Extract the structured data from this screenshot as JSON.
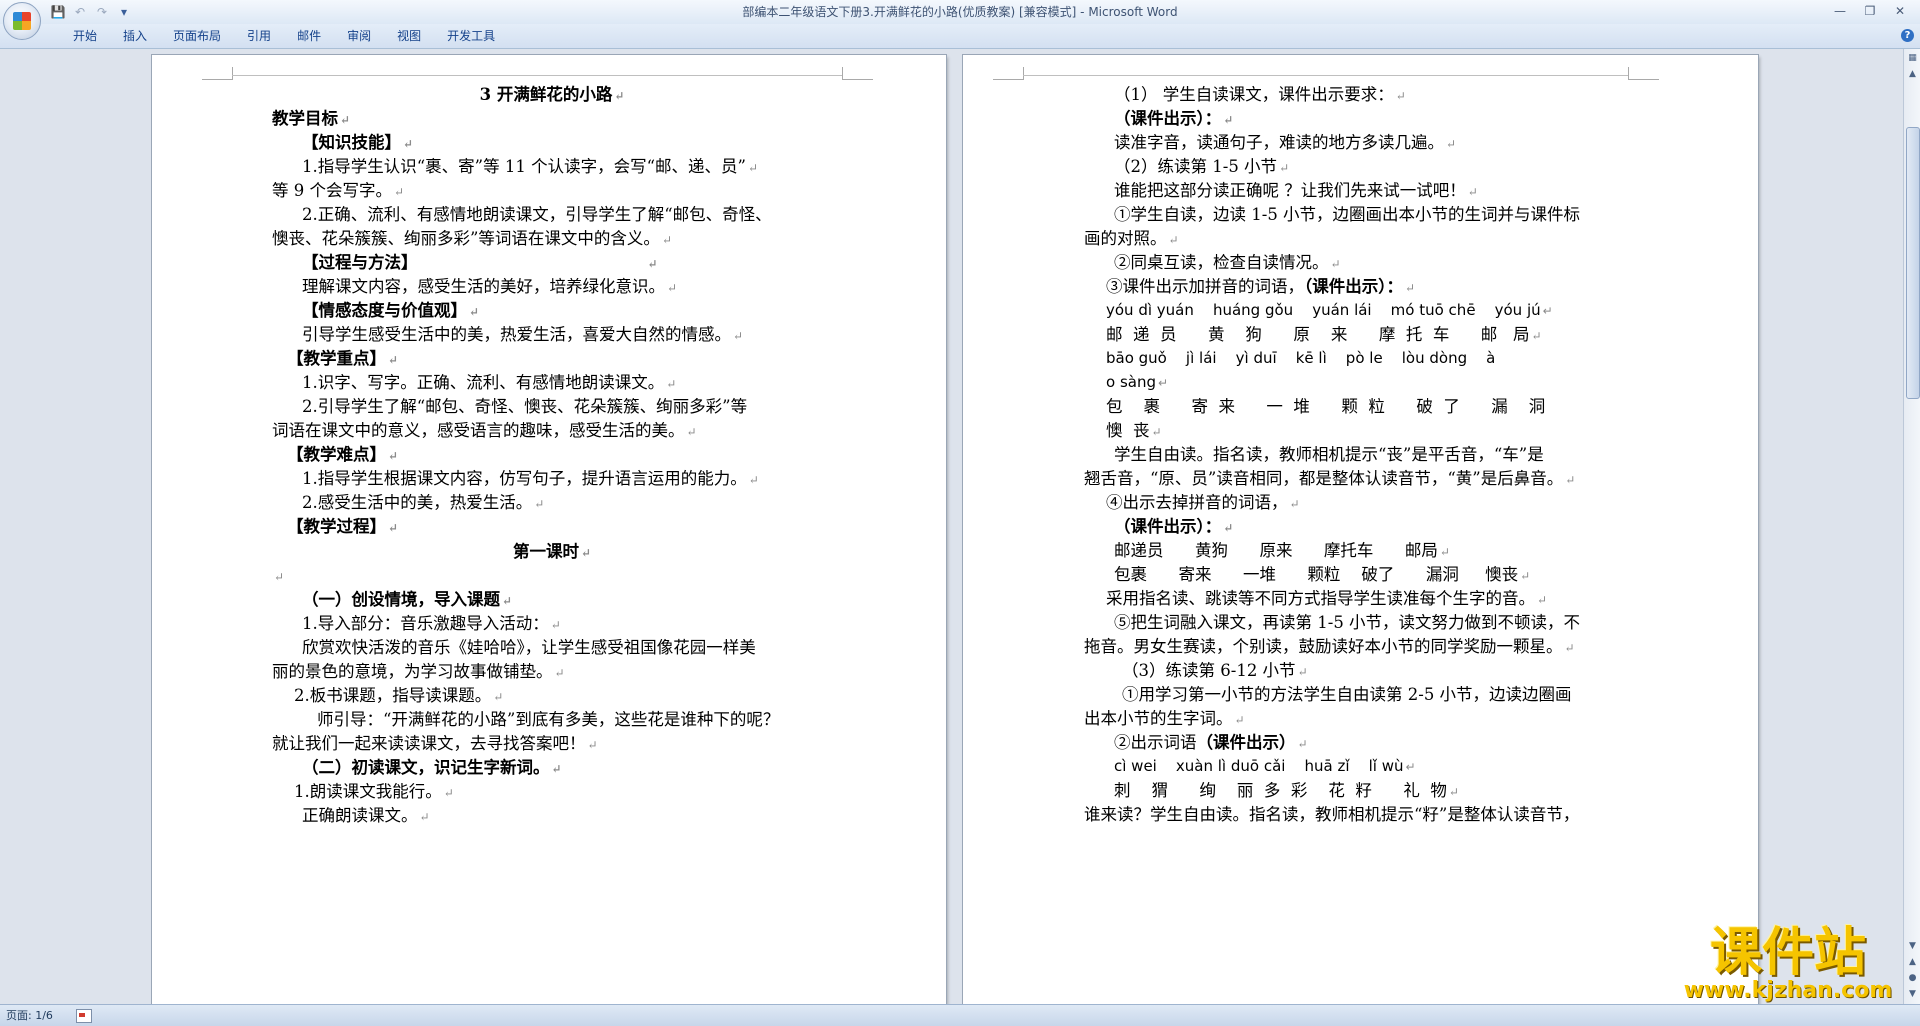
{
  "window": {
    "title": "部编本二年级语文下册3.开满鲜花的小路(优质教案) [兼容模式] - Microsoft Word"
  },
  "qat": {
    "save_icon": "save-icon",
    "undo_icon": "undo-icon",
    "redo_icon": "redo-icon",
    "customize_icon": "chevron-down-icon"
  },
  "ribbon_tabs": [
    "开始",
    "插入",
    "页面布局",
    "引用",
    "邮件",
    "审阅",
    "视图",
    "开发工具"
  ],
  "status": {
    "page": "页面: 1/6"
  },
  "watermark": {
    "title": "课件站",
    "url": "www.kjzhan.com"
  },
  "page_left": {
    "lines": [
      "3 开满鲜花的小路",
      "教学目标",
      "【知识技能】",
      "1.指导学生认识“裹、寄”等 11 个认读字，会写“邮、递、员”",
      "等 9 个会写字。",
      "2.正确、流利、有感情地朗读课文，引导学生了解“邮包、奇怪、",
      "懊丧、花朵簇簇、绚丽多彩”等词语在课文中的含义。",
      "【过程与方法】",
      "理解课文内容，感受生活的美好，培养绿化意识。",
      "【情感态度与价值观】",
      "引导学生感受生活中的美，热爱生活，喜爱大自然的情感。",
      "【教学重点】",
      "1.识字、写字。正确、流利、有感情地朗读课文。",
      "2.引导学生了解“邮包、奇怪、懊丧、花朵簇簇、绚丽多彩”等",
      "词语在课文中的意义，感受语言的趣味，感受生活的美。",
      "【教学难点】",
      "1.指导学生根据课文内容，仿写句子，提升语言运用的能力。",
      "2.感受生活中的美，热爱生活。",
      "【教学过程】",
      "第一课时",
      "",
      "（一）创设情境，导入课题",
      "1.导入部分：音乐激趣导入活动：",
      "欣赏欢快活泼的音乐《娃哈哈》，让学生感受祖国像花园一样美",
      "丽的景色的意境，为学习故事做铺垫。",
      "2.板书课题，指导读课题。",
      "师引导：“开满鲜花的小路”到底有多美，这些花是谁种下的呢？",
      "就让我们一起来读读课文，去寻找答案吧！",
      "（二）初读课文，识记生字新词。",
      "1.朗读课文我能行。",
      "正确朗读课文。"
    ]
  },
  "page_right": {
    "lines": [
      "（1） 学生自读课文，课件出示要求：",
      "（课件出示）：",
      "读准字音，读通句子，难读的地方多读几遍。",
      "（2）练读第 1-5 小节",
      "谁能把这部分读正确呢 ？让我们先来试一试吧！",
      "①学生自读，边读 1-5 小节，边圈画出本小节的生词并与课件标",
      "画的对照。",
      "②同桌互读，检查自读情况。",
      "③课件出示加拼音的词语，",
      "（课件出示）：",
      "yóu dì yuán    huáng gǒu    yuán lái    mó tuō chē    yóu jú",
      "邮  递  员      黄    狗      原    来      摩  托  车      邮   局",
      "bāo guǒ    jì lái    yì duī    kē lì    pò le    lòu dòng    à",
      "o sàng",
      "包    裹      寄  来      一  堆      颗  粒      破  了      漏    洞",
      "懊  丧",
      "学生自由读。指名读，教师相机提示“丧”是平舌音，“车”是",
      "翘舌音，“原、员”读音相同，都是整体认读音节，“黄”是后鼻音。",
      "④出示去掉拼音的词语，",
      "（课件出示）：",
      "邮递员      黄狗      原来      摩托车      邮局",
      "包裹      寄来      一堆      颗粒    破了      漏洞     懊丧",
      "采用指名读、跳读等不同方式指导学生读准每个生字的音。",
      "⑤把生词融入课文，再读第 1-5 小节，读文努力做到不顿读，不",
      "拖音。男女生赛读，个别读，鼓励读好本小节的同学奖励一颗星。",
      "（3）练读第 6-12 小节",
      "①用学习第一小节的方法学生自由读第 2-5 小节，边读边圈画",
      "出本小节的生字词。",
      "②出示词语",
      "（课件出示）",
      "cì wei    xuàn lì duō cǎi    huā zǐ    lǐ wù",
      "刺    猬      绚    丽  多  彩    花  籽      礼  物",
      "谁来读？学生自由读。指名读，教师相机提示“籽”是整体认读音节，"
    ]
  }
}
